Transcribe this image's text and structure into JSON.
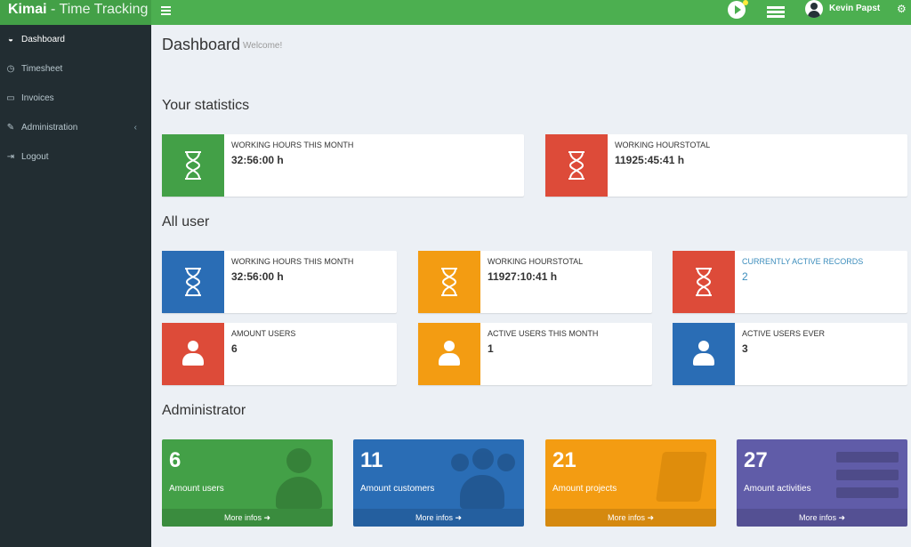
{
  "app": {
    "brand": "Kimai",
    "tagline": "Time Tracking"
  },
  "topbar": {
    "user_name": "Kevin Papst",
    "menu_icon": "hamburger-icon",
    "play_icon": "play-icon",
    "records_icon": "records-icon",
    "settings_icon": "gears-icon"
  },
  "sidebar": {
    "items": [
      {
        "label": "Dashboard",
        "icon": "dashboard-icon",
        "active": true
      },
      {
        "label": "Timesheet",
        "icon": "clock-icon"
      },
      {
        "label": "Invoices",
        "icon": "printer-icon"
      },
      {
        "label": "Administration",
        "icon": "wrench-icon",
        "has_submenu": true
      },
      {
        "label": "Logout",
        "icon": "logout-icon"
      }
    ]
  },
  "page": {
    "title": "Dashboard",
    "subtitle": "Welcome!"
  },
  "sections": {
    "your_statistics": "Your statistics",
    "all_user": "All user",
    "administrator": "Administrator"
  },
  "your_stats": [
    {
      "label": "WORKING HOURS THIS MONTH",
      "value": "32:56:00 h",
      "color": "#43a047",
      "icon": "hourglass-icon"
    },
    {
      "label": "WORKING HOURSTOTAL",
      "value": "11925:45:41 h",
      "color": "#dd4b39",
      "icon": "hourglass-icon"
    }
  ],
  "all_user_stats": [
    {
      "label": "WORKING HOURS THIS MONTH",
      "value": "32:56:00 h",
      "color": "#2a6db5",
      "icon": "hourglass-icon"
    },
    {
      "label": "WORKING HOURSTOTAL",
      "value": "11927:10:41 h",
      "color": "#f39c12",
      "icon": "hourglass-icon"
    },
    {
      "label": "CURRENTLY ACTIVE RECORDS",
      "value": "2",
      "color": "#dd4b39",
      "icon": "hourglass-icon"
    },
    {
      "label": "AMOUNT USERS",
      "value": "6",
      "color": "#dd4b39",
      "icon": "user-icon"
    },
    {
      "label": "ACTIVE USERS THIS MONTH",
      "value": "1",
      "color": "#f39c12",
      "icon": "user-icon"
    },
    {
      "label": "ACTIVE USERS EVER",
      "value": "3",
      "color": "#2a6db5",
      "icon": "user-icon"
    }
  ],
  "admin_boxes": [
    {
      "count": "6",
      "label": "Amount users",
      "more": "More infos",
      "color": "#43a047",
      "icon": "user-icon"
    },
    {
      "count": "11",
      "label": "Amount customers",
      "more": "More infos",
      "color": "#2a6db5",
      "icon": "users-icon"
    },
    {
      "count": "21",
      "label": "Amount projects",
      "more": "More infos",
      "color": "#f39c12",
      "icon": "book-icon"
    },
    {
      "count": "27",
      "label": "Amount activities",
      "more": "More infos",
      "color": "#605ca8",
      "icon": "list-icon"
    }
  ]
}
